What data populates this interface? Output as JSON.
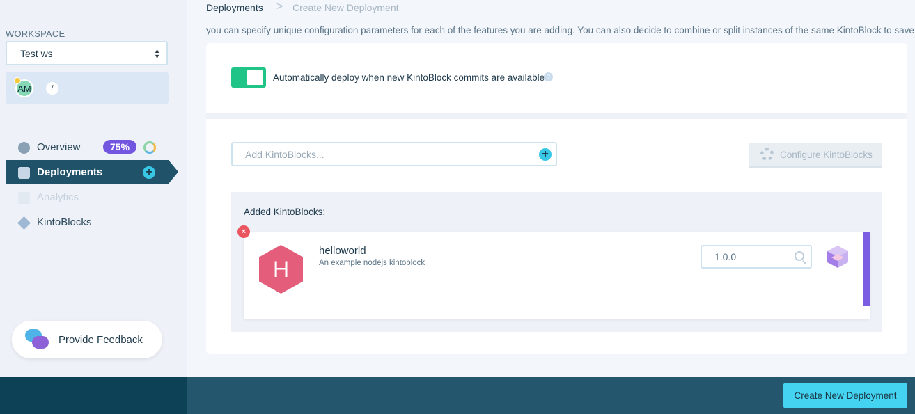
{
  "breadcrumb": {
    "parent": "Deployments",
    "separator": ">",
    "current": "Create New Deployment"
  },
  "description": "you can specify unique configuration parameters for each of the features you are adding. You can also decide to combine or split instances of the same KintoBlock to save on costs.",
  "sidebar": {
    "workspace_label": "WORKSPACE",
    "workspace_selected": "Test ws",
    "member": {
      "initials": "AM",
      "edit_icon": "/"
    },
    "nav": [
      {
        "label": "Overview",
        "icon": "overview-icon"
      },
      {
        "label": "Deployments",
        "icon": "deployments-icon"
      },
      {
        "label": "Analytics",
        "icon": "analytics-icon"
      },
      {
        "label": "KintoBlocks",
        "icon": "kintoblocks-icon"
      }
    ],
    "overview_badge": "75%",
    "feedback_label": "Provide Feedback"
  },
  "auto_deploy": {
    "label": "Automatically deploy when new KintoBlock commits are available",
    "enabled": true,
    "help": "?"
  },
  "kb_input": {
    "placeholder": "Add KintoBlocks...",
    "add_icon": "+"
  },
  "configure_button": "Configure KintoBlocks",
  "added_section": {
    "title": "Added KintoBlocks:",
    "items": [
      {
        "letter": "H",
        "name": "helloworld",
        "description": "An example nodejs kintoblock",
        "version": "1.0.0",
        "remove_icon": "×"
      }
    ]
  },
  "footer": {
    "create_button": "Create New Deployment"
  },
  "colors": {
    "accent": "#7a5de2",
    "primary": "#20536a",
    "toggle": "#20c487",
    "cta": "#44d4f1",
    "danger": "#ea5560"
  }
}
